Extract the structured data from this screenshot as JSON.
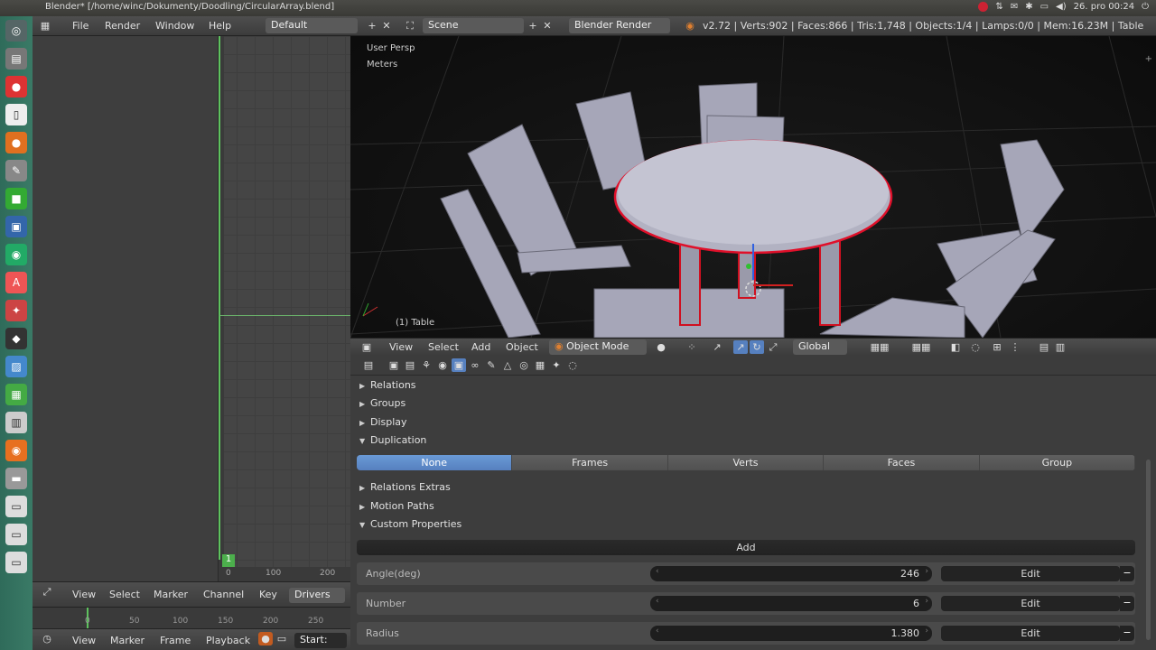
{
  "os": {
    "window_title": "Blender* [/home/winc/Dokumenty/Doodling/CircularArray.blend]",
    "clock": "26. pro 00:24"
  },
  "header": {
    "menus": [
      "File",
      "Render",
      "Window",
      "Help"
    ],
    "screen_layout": "Default",
    "scene": "Scene",
    "render_engine": "Blender Render",
    "stats": "v2.72 | Verts:902 | Faces:866 | Tris:1,748 | Objects:1/4 | Lamps:0/0 | Mem:16.23M | Table"
  },
  "viewport": {
    "view_name": "User Persp",
    "units": "Meters",
    "object_label": "(1) Table",
    "footer": {
      "menus": [
        "View",
        "Select",
        "Add",
        "Object"
      ],
      "mode": "Object Mode",
      "orientation": "Global"
    }
  },
  "graph_editor": {
    "frame_indicator": "1",
    "ruler_ticks": [
      "0",
      "100",
      "200"
    ],
    "footer_menus": [
      "View",
      "Select",
      "Marker",
      "Channel",
      "Key"
    ],
    "mode": "Drivers"
  },
  "timeline": {
    "ticks": [
      "0",
      "50",
      "100",
      "150",
      "200",
      "250"
    ],
    "footer_menus": [
      "View",
      "Marker",
      "Frame",
      "Playback"
    ],
    "start_label": "Start:"
  },
  "properties": {
    "panels": {
      "relations": "Relations",
      "groups": "Groups",
      "display": "Display",
      "duplication": "Duplication",
      "relations_extras": "Relations Extras",
      "motion_paths": "Motion Paths",
      "custom_properties": "Custom Properties"
    },
    "duplication_options": [
      "None",
      "Frames",
      "Verts",
      "Faces",
      "Group"
    ],
    "duplication_selected": "None",
    "add_label": "Add",
    "custom_props": [
      {
        "name": "Angle(deg)",
        "value": "246",
        "edit": "Edit"
      },
      {
        "name": "Number",
        "value": "6",
        "edit": "Edit"
      },
      {
        "name": "Radius",
        "value": "1.380",
        "edit": "Edit"
      }
    ]
  }
}
